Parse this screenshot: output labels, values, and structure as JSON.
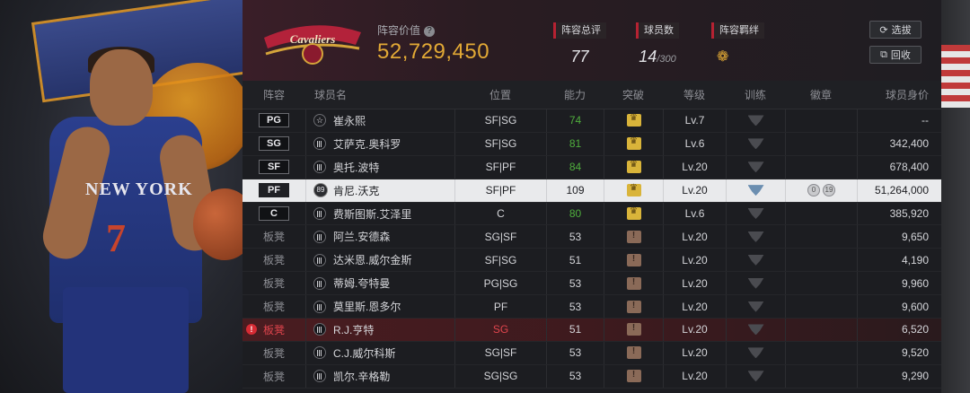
{
  "header": {
    "team": "CLEVELAND CAVALIERS",
    "value_label": "阵容价值",
    "value": "52,729,450",
    "stats": [
      {
        "label": "阵容总评",
        "value": "77"
      },
      {
        "label": "球员数",
        "value": "14",
        "total": "/300"
      },
      {
        "label": "阵容羁绊",
        "value": ""
      }
    ],
    "buttons": {
      "draft": "选拔",
      "back": "回收"
    }
  },
  "table": {
    "columns": [
      "阵容",
      "球员名",
      "位置",
      "能力",
      "突破",
      "等级",
      "训练",
      "徽章",
      "球员身价"
    ],
    "rows": [
      {
        "slot": "PG",
        "name": "崔永熙",
        "pos": "SF|SG",
        "ability": "74",
        "level": "Lv.7",
        "price": "--",
        "icon": "star"
      },
      {
        "slot": "SG",
        "name": "艾萨克.奥科罗",
        "pos": "SF|SG",
        "ability": "81",
        "level": "Lv.6",
        "price": "342,400",
        "icon": "bars"
      },
      {
        "slot": "SF",
        "name": "奥托.波特",
        "pos": "SF|PF",
        "ability": "84",
        "level": "Lv.20",
        "price": "678,400",
        "icon": "bars"
      },
      {
        "slot": "PF",
        "name": "肯尼.沃克",
        "pos": "SF|PF",
        "ability": "109",
        "level": "Lv.20",
        "price": "51,264,000",
        "icon": "num",
        "icon_text": "89",
        "badges": [
          "0",
          "19"
        ]
      },
      {
        "slot": "C",
        "name": "费斯图斯.艾泽里",
        "pos": "C",
        "ability": "80",
        "level": "Lv.6",
        "price": "385,920",
        "icon": "bars"
      },
      {
        "slot": "板凳",
        "name": "阿兰.安德森",
        "pos": "SG|SF",
        "ability": "53",
        "level": "Lv.20",
        "price": "9,650",
        "icon": "bars"
      },
      {
        "slot": "板凳",
        "name": "达米恩.威尔金斯",
        "pos": "SF|SG",
        "ability": "51",
        "level": "Lv.20",
        "price": "4,190",
        "icon": "bars"
      },
      {
        "slot": "板凳",
        "name": "蒂姆.夸特曼",
        "pos": "PG|SG",
        "ability": "53",
        "level": "Lv.20",
        "price": "9,960",
        "icon": "bars"
      },
      {
        "slot": "板凳",
        "name": "莫里斯.恩多尔",
        "pos": "PF",
        "ability": "53",
        "level": "Lv.20",
        "price": "9,600",
        "icon": "bars"
      },
      {
        "slot": "板凳",
        "name": "R.J.亨特",
        "pos": "SG",
        "ability": "51",
        "level": "Lv.20",
        "price": "6,520",
        "icon": "bars",
        "warn": "!"
      },
      {
        "slot": "板凳",
        "name": "C.J.威尔科斯",
        "pos": "SG|SF",
        "ability": "53",
        "level": "Lv.20",
        "price": "9,520",
        "icon": "bars"
      },
      {
        "slot": "板凳",
        "name": "凯尔.辛格勒",
        "pos": "SG|SG",
        "ability": "53",
        "level": "Lv.20",
        "price": "9,290",
        "icon": "bars"
      }
    ]
  },
  "player_art": {
    "jersey": "NEW YORK",
    "number": "7"
  },
  "colors": {
    "accent": "#e2a935",
    "highlight_row": "#e9eaec",
    "warn_row": "#4a1c20",
    "ability_green": "#4fae3d",
    "position_red": "#e0454d"
  }
}
